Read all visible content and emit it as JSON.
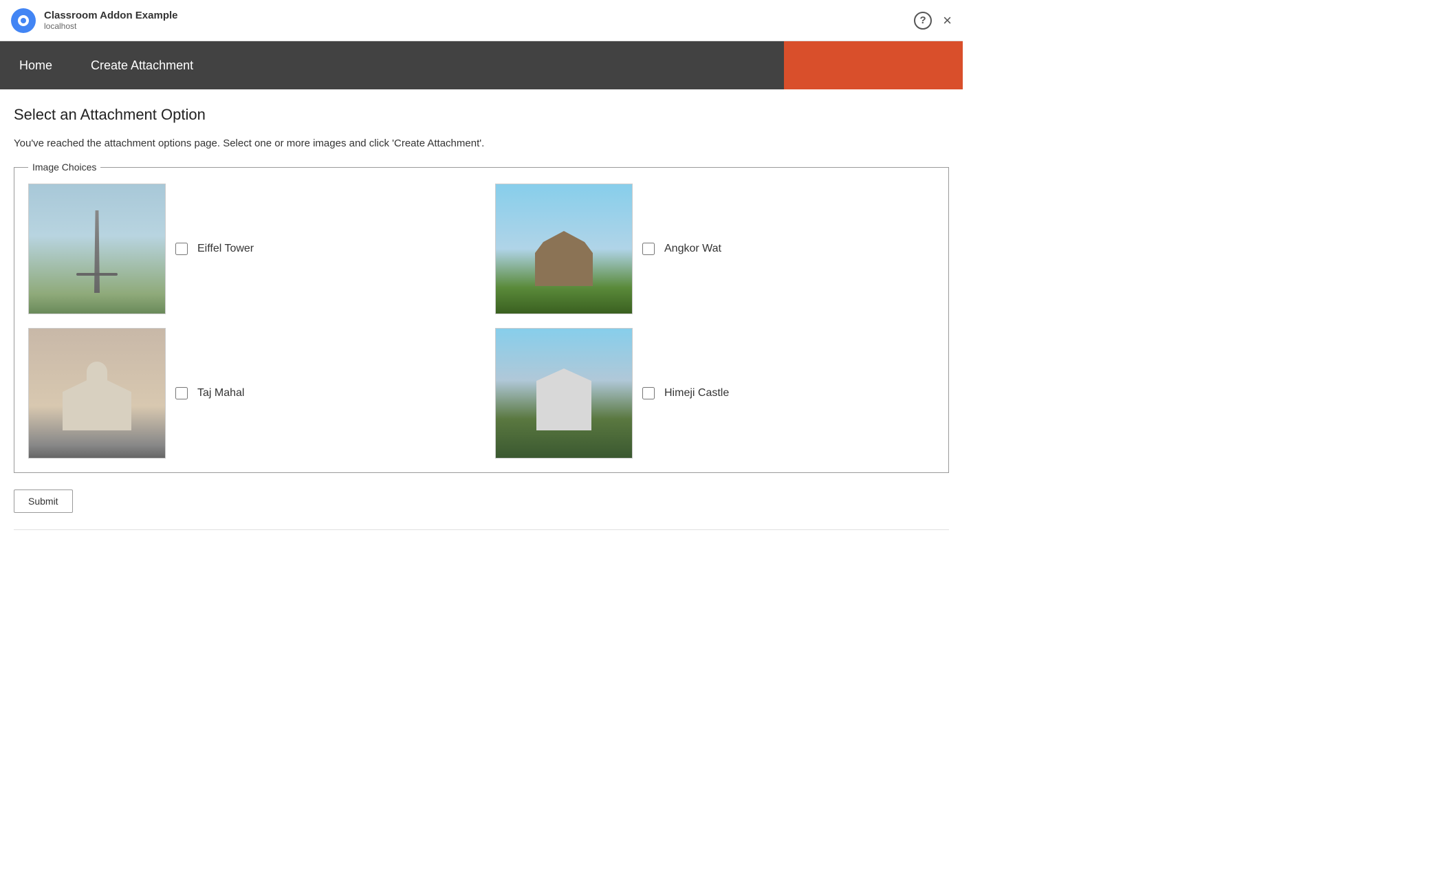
{
  "titleBar": {
    "appTitle": "Classroom Addon Example",
    "appUrl": "localhost",
    "helpLabel": "?",
    "closeLabel": "×"
  },
  "navBar": {
    "items": [
      {
        "id": "home",
        "label": "Home"
      },
      {
        "id": "create-attachment",
        "label": "Create Attachment"
      }
    ]
  },
  "main": {
    "pageTitle": "Select an Attachment Option",
    "description": "You've reached the attachment options page. Select one or more images and click 'Create Attachment'.",
    "imageChoices": {
      "legend": "Image Choices",
      "images": [
        {
          "id": "eiffel",
          "label": "Eiffel Tower",
          "cssClass": "img-eiffel"
        },
        {
          "id": "angkor",
          "label": "Angkor Wat",
          "cssClass": "img-angkor"
        },
        {
          "id": "taj",
          "label": "Taj Mahal",
          "cssClass": "img-taj"
        },
        {
          "id": "himeji",
          "label": "Himeji Castle",
          "cssClass": "img-himeji"
        }
      ]
    },
    "submitLabel": "Submit"
  }
}
